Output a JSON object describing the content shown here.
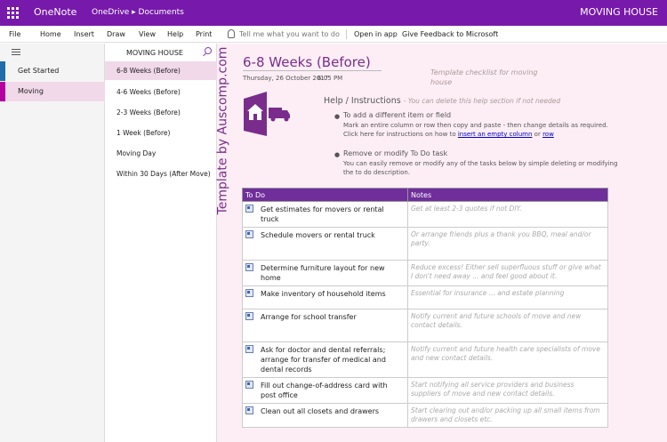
{
  "titlebar": {
    "app_name": "OneNote",
    "breadcrumb": "OneDrive ▸ Documents",
    "notebook_name": "MOVING HOUSE"
  },
  "ribbon": {
    "tabs": [
      "File",
      "Home",
      "Insert",
      "Draw",
      "View",
      "Help",
      "Print"
    ],
    "tell_me": "Tell me what you want to do",
    "open_in_app": "Open in app",
    "feedback": "Give Feedback to Microsoft"
  },
  "notebook_header": "MOVING HOUSE",
  "sections": [
    {
      "label": "Get Started",
      "color": "#1f6dab"
    },
    {
      "label": "Moving",
      "color": "#b4009e"
    }
  ],
  "pages": [
    "6-8 Weeks (Before)",
    "4-6 Weeks (Before)",
    "2-3 Weeks (Before)",
    "1 Week (Before)",
    "Moving Day",
    "Within 30 Days (After Move)"
  ],
  "page": {
    "vertical_text": "Template by Auscomp.com",
    "title": "6-8 Weeks (Before)",
    "date": "Thursday, 26 October 2017",
    "time": "6:05 PM",
    "template_note": "Template checklist for moving house",
    "help_heading": "Help / Instructions",
    "help_note": "- You can delete this help section if not needed",
    "bullet1_title": "To add a different item or field",
    "bullet1_line1": "Mark an entire column or row then copy and paste - then change details as required.",
    "bullet1_line2_pre": "Click here for instructions on how to ",
    "bullet1_link1": "insert an empty column",
    "bullet1_or": " or ",
    "bullet1_link2": "row",
    "bullet2_title": "Remove or modify To Do task",
    "bullet2_text": "You can easily remove or modify any of the tasks below by simple deleting or modifying the to do description."
  },
  "table": {
    "headers": [
      "To Do",
      "Notes"
    ],
    "rows": [
      {
        "task": "Get estimates for movers or rental truck",
        "note": "Get at least 2-3 quotes if not DIY."
      },
      {
        "task": "Schedule movers or rental truck",
        "note": "Or arrange friends plus a thank you BBQ, meal and/or party."
      },
      {
        "task": "Determine furniture layout for new home",
        "note": "Reduce excess! Either sell superfluous stuff or give what I don't need away ... and feel good about it."
      },
      {
        "task": "Make inventory of household items",
        "note": "Essential for insurance ... and estate planning"
      },
      {
        "task": "Arrange for school transfer",
        "note": "Notify current and future schools of move and new contact details."
      },
      {
        "task": "Ask for doctor and dental referrals; arrange for transfer of medical and dental records",
        "note": "Notify current and future health care specialists of move and new contact details."
      },
      {
        "task": "Fill out change-of-address card with post office",
        "note": "Start notifying all service providers and business suppliers of move and new contact details."
      },
      {
        "task": "Clean out all closets and drawers",
        "note": "Start clearing out and/or packing up all small items from drawers and closets etc."
      }
    ]
  },
  "colors": {
    "brand": "#7719aa",
    "table_header": "#6f2e9b",
    "canvas": "#fdeef5"
  }
}
